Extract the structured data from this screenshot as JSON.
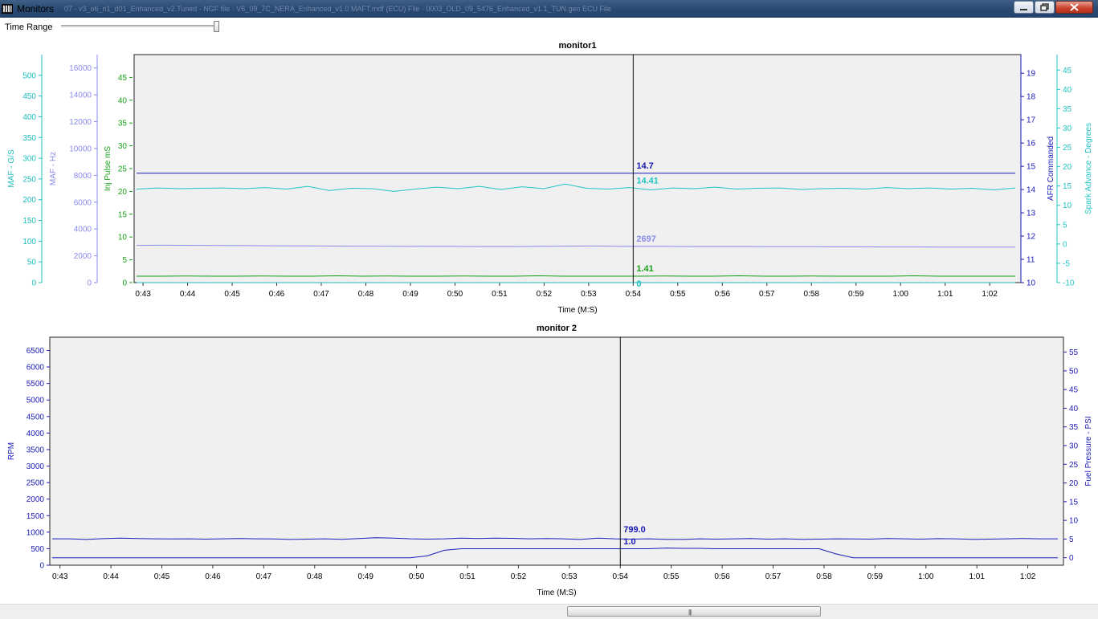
{
  "window": {
    "title": "Monitors",
    "ghost_text": "07 - v3_o6_n1_d01_Enhanced_v2.Tuned - NGF file  ·  V6_09_7C_NERA_Enhanced_v1.0 MAFT.mdf (ECU) File  ·  0003_OLD_09_5476_Enhanced_v1.1_TUN.gen  ECU File"
  },
  "toolbar": {
    "time_range_label": "Time Range",
    "time_range_value": 1.0
  },
  "colors": {
    "maf_gs": "#1fbdbd",
    "maf_hz": "#8a8af0",
    "inj_pulse": "#18a018",
    "afr": "#1818b8",
    "spark": "#22c4c4",
    "monitor2": "#1a1ab8",
    "plot_bg": "#f0f0f0"
  },
  "x_ticks": [
    "0:43",
    "0:44",
    "0:45",
    "0:46",
    "0:47",
    "0:48",
    "0:49",
    "0:50",
    "0:51",
    "0:52",
    "0:53",
    "0:54",
    "0:55",
    "0:56",
    "0:57",
    "0:58",
    "0:59",
    "1:00",
    "1:01",
    "1:02"
  ],
  "chart_data": [
    {
      "type": "line",
      "title": "monitor1",
      "xlabel": "Time (M:S)",
      "x_range_seconds": [
        42.8,
        62.7
      ],
      "cursor_x": "0:54",
      "axes": {
        "maf_gs": {
          "label": "MAF - G/S",
          "range": [
            0,
            550
          ],
          "ticks": [
            0,
            50,
            100,
            150,
            200,
            250,
            300,
            350,
            400,
            450,
            500
          ]
        },
        "maf_hz": {
          "label": "MAF - Hz",
          "range": [
            0,
            17000
          ],
          "ticks": [
            0,
            2000,
            4000,
            6000,
            8000,
            10000,
            12000,
            14000,
            16000
          ]
        },
        "inj_pulse": {
          "label": "Inj Pulse mS",
          "range": [
            0,
            50
          ],
          "ticks": [
            0,
            5,
            10,
            15,
            20,
            25,
            30,
            35,
            40,
            45
          ]
        },
        "afr": {
          "label": "AFR Commanded",
          "range": [
            10,
            19.8
          ],
          "ticks": [
            10,
            11,
            12,
            13,
            14,
            15,
            16,
            17,
            18,
            19
          ]
        },
        "spark": {
          "label": "Spark Advance - Degrees",
          "range": [
            -10,
            49
          ],
          "ticks": [
            -10,
            -5,
            0,
            5,
            10,
            15,
            20,
            25,
            30,
            35,
            40,
            45
          ]
        }
      },
      "series": [
        {
          "name": "AFR Commanded",
          "axis": "afr",
          "cursor_label": "14.7",
          "values": [
            14.7,
            14.7,
            14.7,
            14.7,
            14.7,
            14.7,
            14.7,
            14.7,
            14.7,
            14.7,
            14.7,
            14.7,
            14.7,
            14.7,
            14.7,
            14.7,
            14.7,
            14.7,
            14.7,
            14.7,
            14.7
          ]
        },
        {
          "name": "Spark Advance - Degrees",
          "axis": "spark",
          "cursor_label": "14.41",
          "values": [
            14.2,
            14.5,
            14.3,
            14.4,
            14.5,
            14.3,
            14.6,
            14.2,
            14.9,
            13.8,
            14.4,
            14.3,
            13.6,
            14.2,
            14.7,
            14.3,
            14.9,
            14.1,
            14.8,
            14.3,
            15.5,
            14.4,
            14.2,
            14.6,
            14.0,
            14.5,
            14.3,
            14.7,
            14.2,
            14.4,
            14.5,
            14.1,
            14.3,
            14.4,
            14.2,
            14.6,
            14.3,
            14.5,
            14.2,
            14.4,
            14.0,
            14.5
          ]
        },
        {
          "name": "MAF - Hz",
          "axis": "maf_hz",
          "cursor_label": "2697",
          "values": [
            2780,
            2790,
            2780,
            2770,
            2760,
            2750,
            2740,
            2730,
            2720,
            2720,
            2710,
            2700,
            2700,
            2690,
            2690,
            2700,
            2720,
            2730,
            2710,
            2700,
            2697,
            2690,
            2690,
            2690,
            2680,
            2680,
            2670,
            2670,
            2660,
            2660,
            2650,
            2650,
            2650,
            2650
          ]
        },
        {
          "name": "Inj Pulse mS",
          "axis": "inj_pulse",
          "cursor_label": "1.41",
          "values": [
            1.4,
            1.4,
            1.45,
            1.4,
            1.4,
            1.45,
            1.4,
            1.4,
            1.5,
            1.4,
            1.45,
            1.4,
            1.4,
            1.45,
            1.4,
            1.4,
            1.5,
            1.4,
            1.41,
            1.4,
            1.4,
            1.45,
            1.4,
            1.4,
            1.5,
            1.4,
            1.4,
            1.45,
            1.4,
            1.4,
            1.4,
            1.5,
            1.4,
            1.4,
            1.4,
            1.4
          ]
        },
        {
          "name": "MAF - G/S",
          "axis": "maf_gs",
          "cursor_label": "0",
          "values": [
            0,
            0,
            0,
            0,
            0,
            0,
            0,
            0,
            0,
            0
          ]
        }
      ]
    },
    {
      "type": "line",
      "title": "monitor 2",
      "xlabel": "Time (M:S)",
      "x_range_seconds": [
        42.8,
        62.7
      ],
      "cursor_x": "0:54",
      "axes": {
        "rpm": {
          "label": "RPM",
          "range": [
            0,
            6900
          ],
          "ticks": [
            0,
            500,
            1000,
            1500,
            2000,
            2500,
            3000,
            3500,
            4000,
            4500,
            5000,
            5500,
            6000,
            6500
          ]
        },
        "fuel": {
          "label": "Fuel Pressure - PSI",
          "range": [
            -2,
            59
          ],
          "ticks": [
            0,
            5,
            10,
            15,
            20,
            25,
            30,
            35,
            40,
            45,
            50,
            55
          ]
        }
      },
      "series": [
        {
          "name": "RPM",
          "axis": "rpm",
          "cursor_label": "799.0",
          "values": [
            799,
            799,
            780,
            805,
            820,
            810,
            800,
            795,
            800,
            790,
            800,
            810,
            800,
            795,
            780,
            790,
            800,
            785,
            810,
            830,
            820,
            800,
            790,
            800,
            820,
            810,
            820,
            815,
            799,
            810,
            800,
            780,
            820,
            800,
            790,
            800,
            785,
            780,
            800,
            790,
            800,
            810,
            790,
            800,
            785,
            790,
            800,
            795,
            790,
            810,
            800,
            790,
            805,
            800,
            785,
            790,
            800,
            810,
            800,
            800
          ]
        },
        {
          "name": "Fuel Pressure - PSI",
          "axis": "fuel",
          "cursor_label": "1.0",
          "values": [
            0,
            0,
            0,
            0,
            0,
            0,
            0,
            0,
            0,
            0,
            0,
            0,
            0,
            0,
            0,
            0,
            0,
            0,
            0,
            0,
            0,
            0,
            0.5,
            2.0,
            2.4,
            2.4,
            2.4,
            2.4,
            2.4,
            2.4,
            2.4,
            2.4,
            2.4,
            2.4,
            2.4,
            2.4,
            2.6,
            2.5,
            2.5,
            2.4,
            2.4,
            2.4,
            2.4,
            2.4,
            2.4,
            2.4,
            1.0,
            0,
            0,
            0,
            0,
            0,
            0,
            0,
            0,
            0,
            0,
            0,
            0,
            0
          ]
        }
      ]
    }
  ]
}
